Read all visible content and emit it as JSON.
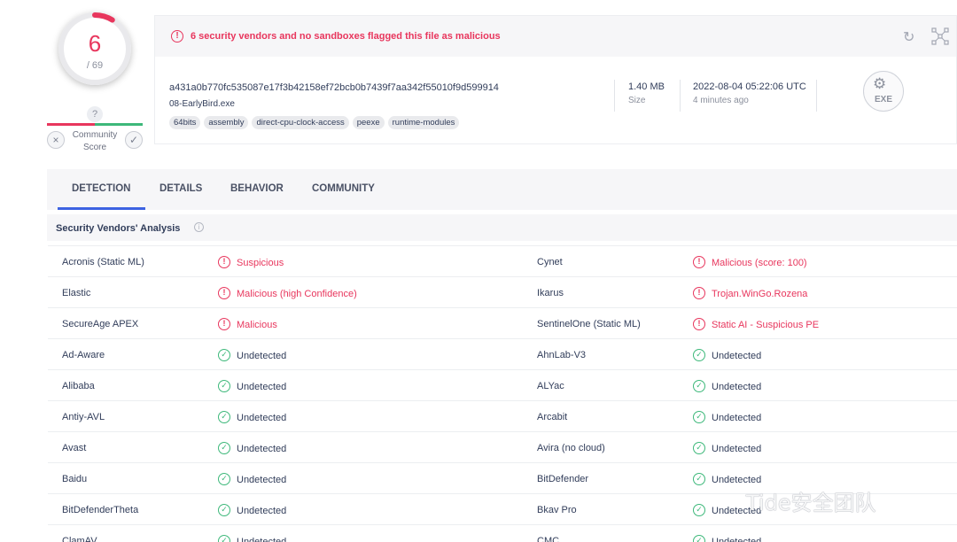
{
  "score": {
    "detections": "6",
    "total": "/ 69",
    "fraction": 0.087
  },
  "community": {
    "unknown": "?",
    "label_line1": "Community",
    "label_line2": "Score",
    "down": "×",
    "up": "✓"
  },
  "alert": {
    "icon": "!",
    "text": "6 security vendors and no sandboxes flagged this file as malicious"
  },
  "file": {
    "hash": "a431a0b770fc535087e17f3b42158ef72bcb0b7439f7aa342f55010f9d599914",
    "name": "08-EarlyBird.exe",
    "tags": [
      "64bits",
      "assembly",
      "direct-cpu-clock-access",
      "peexe",
      "runtime-modules"
    ],
    "size_value": "1.40 MB",
    "size_label": "Size",
    "date_value": "2022-08-04 05:22:06 UTC",
    "date_label": "4 minutes ago",
    "type": "EXE"
  },
  "tabs": [
    "DETECTION",
    "DETAILS",
    "BEHAVIOR",
    "COMMUNITY"
  ],
  "section": {
    "title": "Security Vendors' Analysis",
    "info": "i"
  },
  "vendors": [
    {
      "left": {
        "name": "Acronis (Static ML)",
        "result": "Suspicious",
        "status": "mal"
      },
      "right": {
        "name": "Cynet",
        "result": "Malicious (score: 100)",
        "status": "mal"
      }
    },
    {
      "left": {
        "name": "Elastic",
        "result": "Malicious (high Confidence)",
        "status": "mal"
      },
      "right": {
        "name": "Ikarus",
        "result": "Trojan.WinGo.Rozena",
        "status": "mal"
      }
    },
    {
      "left": {
        "name": "SecureAge APEX",
        "result": "Malicious",
        "status": "mal"
      },
      "right": {
        "name": "SentinelOne (Static ML)",
        "result": "Static AI - Suspicious PE",
        "status": "mal"
      }
    },
    {
      "left": {
        "name": "Ad-Aware",
        "result": "Undetected",
        "status": "ok"
      },
      "right": {
        "name": "AhnLab-V3",
        "result": "Undetected",
        "status": "ok"
      }
    },
    {
      "left": {
        "name": "Alibaba",
        "result": "Undetected",
        "status": "ok"
      },
      "right": {
        "name": "ALYac",
        "result": "Undetected",
        "status": "ok"
      }
    },
    {
      "left": {
        "name": "Antiy-AVL",
        "result": "Undetected",
        "status": "ok"
      },
      "right": {
        "name": "Arcabit",
        "result": "Undetected",
        "status": "ok"
      }
    },
    {
      "left": {
        "name": "Avast",
        "result": "Undetected",
        "status": "ok"
      },
      "right": {
        "name": "Avira (no cloud)",
        "result": "Undetected",
        "status": "ok"
      }
    },
    {
      "left": {
        "name": "Baidu",
        "result": "Undetected",
        "status": "ok"
      },
      "right": {
        "name": "BitDefender",
        "result": "Undetected",
        "status": "ok"
      }
    },
    {
      "left": {
        "name": "BitDefenderTheta",
        "result": "Undetected",
        "status": "ok"
      },
      "right": {
        "name": "Bkav Pro",
        "result": "Undetected",
        "status": "ok"
      }
    },
    {
      "left": {
        "name": "ClamAV",
        "result": "Undetected",
        "status": "ok"
      },
      "right": {
        "name": "CMC",
        "result": "Undetected",
        "status": "ok"
      }
    }
  ],
  "watermark": "Tide安全团队",
  "colors": {
    "malicious": "#e8365d",
    "clean": "#3db87a",
    "accent": "#3d63e2"
  }
}
